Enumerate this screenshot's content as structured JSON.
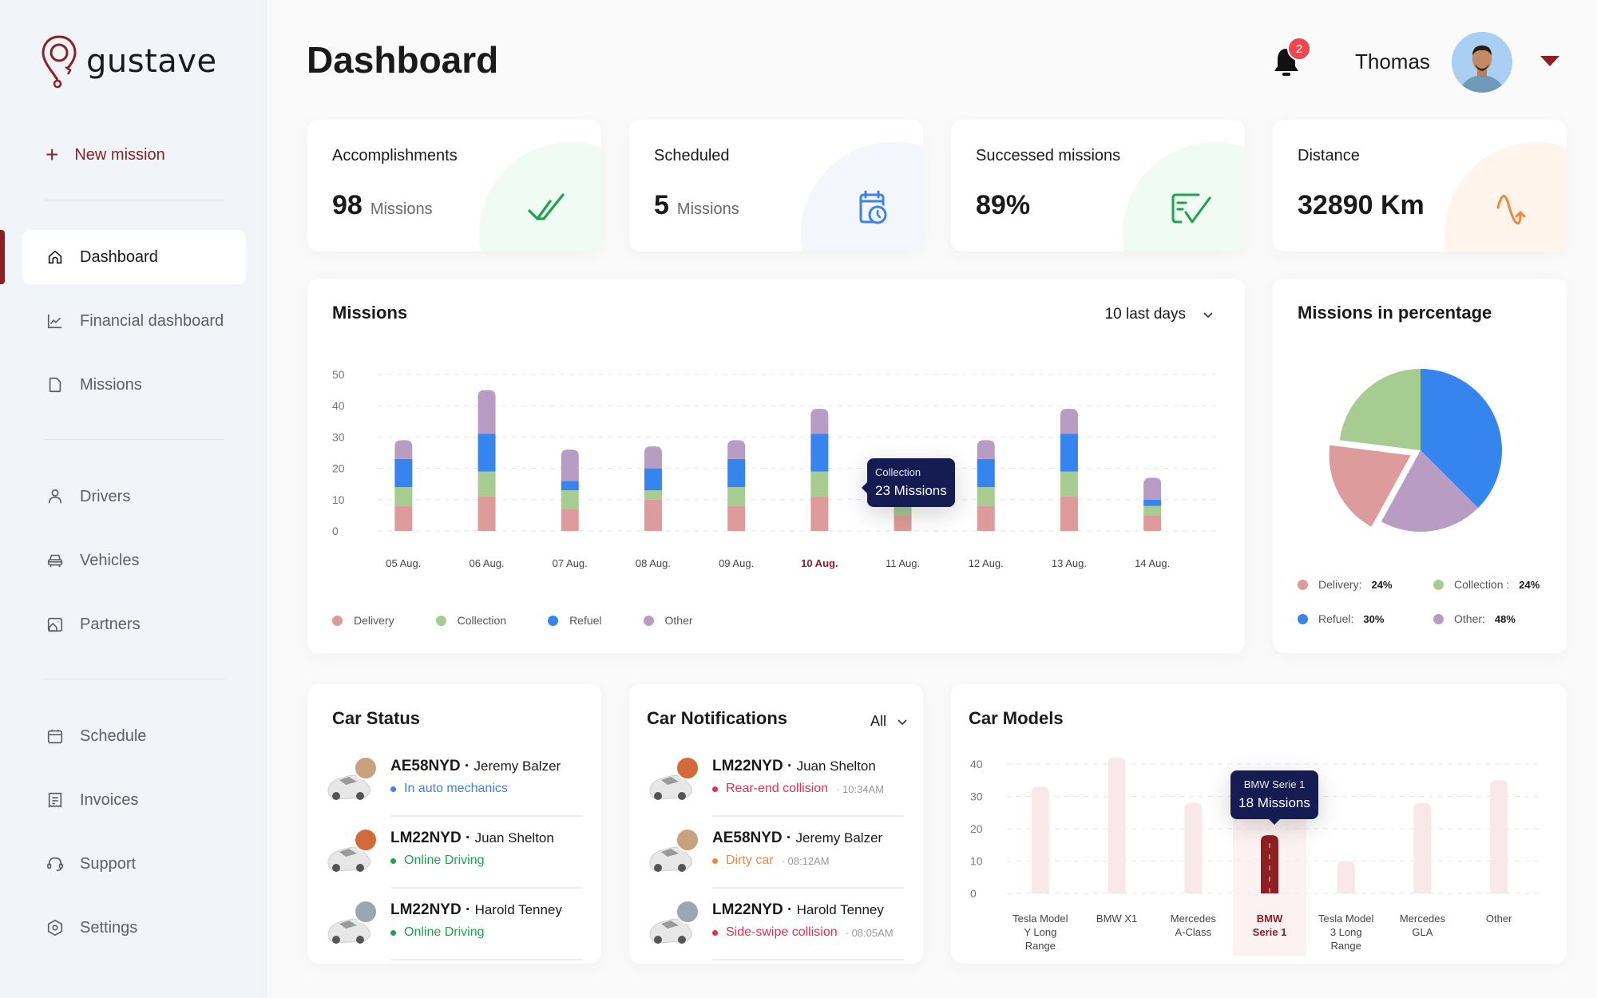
{
  "app": {
    "brand": "gustave"
  },
  "sidebar": {
    "new_mission": "New mission",
    "items": [
      {
        "label": "Dashboard",
        "icon": "home-icon",
        "active": true
      },
      {
        "label": "Financial dashboard",
        "icon": "line-chart-icon"
      },
      {
        "label": "Missions",
        "icon": "document-icon"
      },
      {
        "label": "Drivers",
        "icon": "user-icon"
      },
      {
        "label": "Vehicles",
        "icon": "car-icon"
      },
      {
        "label": "Partners",
        "icon": "building-icon"
      },
      {
        "label": "Schedule",
        "icon": "calendar-icon"
      },
      {
        "label": "Invoices",
        "icon": "receipt-icon"
      },
      {
        "label": "Support",
        "icon": "headset-icon"
      },
      {
        "label": "Settings",
        "icon": "settings-icon"
      }
    ]
  },
  "header": {
    "title": "Dashboard",
    "notifications_count": "2",
    "user_name": "Thomas"
  },
  "stats": [
    {
      "label": "Accomplishments",
      "value": "98",
      "unit": "Missions",
      "icon": "double-check-icon",
      "color": "#1fa34a",
      "bg": "#f0fbf3"
    },
    {
      "label": "Scheduled",
      "value": "5",
      "unit": "Missions",
      "icon": "calendar-clock-icon",
      "color": "#3b82f0",
      "bg": "#f3f7fd"
    },
    {
      "label": "Successed missions",
      "value": "89%",
      "unit": "",
      "icon": "checklist-icon",
      "color": "#1fa34a",
      "bg": "#f0fbf3"
    },
    {
      "label": "Distance",
      "value": "32890 Km",
      "unit": "",
      "icon": "route-icon",
      "color": "#f0883a",
      "bg": "#fff5ec"
    }
  ],
  "missions_chart": {
    "title": "Missions",
    "range": "10 last days",
    "tooltip": {
      "label": "Collection",
      "value": "23 Missions"
    },
    "legend": [
      "Delivery",
      "Collection",
      "Refuel",
      "Other"
    ]
  },
  "pie": {
    "title": "Missions in percentage",
    "legend": [
      {
        "label": "Delivery:",
        "pct": "24%",
        "color": "#de9b9b"
      },
      {
        "label": "Collection :",
        "pct": "24%",
        "color": "#a6cc92"
      },
      {
        "label": "Refuel:",
        "pct": "30%",
        "color": "#3685ef"
      },
      {
        "label": "Other:",
        "pct": "48%",
        "color": "#b89cc4"
      }
    ]
  },
  "car_status": {
    "title": "Car Status",
    "items": [
      {
        "plate": "AE58NYD",
        "driver": "Jeremy Balzer",
        "status": "In auto mechanics",
        "color": "#3b82f0",
        "time": ""
      },
      {
        "plate": "LM22NYD",
        "driver": "Juan Shelton",
        "status": "Online Driving",
        "color": "#1fa34a",
        "time": ""
      },
      {
        "plate": "LM22NYD",
        "driver": "Harold Tenney",
        "status": "Online Driving",
        "color": "#1fa34a",
        "time": ""
      }
    ]
  },
  "car_notifications": {
    "title": "Car Notifications",
    "filter": "All",
    "items": [
      {
        "plate": "LM22NYD",
        "driver": "Juan Shelton",
        "status": "Rear-end collision",
        "color": "#ec2d4b",
        "time": "10:34AM"
      },
      {
        "plate": "AE58NYD",
        "driver": "Jeremy Balzer",
        "status": "Dirty car",
        "color": "#f0883a",
        "time": "08:12AM"
      },
      {
        "plate": "LM22NYD",
        "driver": "Harold Tenney",
        "status": "Side-swipe collision",
        "color": "#ec2d4b",
        "time": "08:05AM"
      }
    ]
  },
  "car_models": {
    "title": "Car Models",
    "tooltip": {
      "label": "BMW Serie 1",
      "value": "18 Missions"
    }
  },
  "chart_data": [
    {
      "type": "bar",
      "stacked": true,
      "title": "Missions",
      "categories": [
        "05 Aug.",
        "06 Aug.",
        "07 Aug.",
        "08 Aug.",
        "09 Aug.",
        "10 Aug.",
        "11 Aug.",
        "12 Aug.",
        "13 Aug.",
        "14 Aug."
      ],
      "highlighted_category": "10 Aug.",
      "series": [
        {
          "name": "Delivery",
          "color": "#de9b9b",
          "values": [
            8,
            11,
            7,
            10,
            8,
            11,
            5,
            8,
            11,
            5
          ]
        },
        {
          "name": "Collection",
          "color": "#a6cc92",
          "values": [
            6,
            8,
            6,
            3,
            6,
            8,
            4,
            6,
            8,
            3
          ]
        },
        {
          "name": "Refuel",
          "color": "#3685ef",
          "values": [
            9,
            12,
            3,
            7,
            9,
            12,
            5,
            9,
            12,
            2
          ]
        },
        {
          "name": "Other",
          "color": "#b89cc4",
          "values": [
            6,
            14,
            10,
            7,
            6,
            8,
            6,
            6,
            8,
            7
          ]
        }
      ],
      "yticks": [
        0,
        10,
        20,
        30,
        40,
        50
      ],
      "ylim": [
        0,
        50
      ],
      "grid": true,
      "legend": "bottom-left"
    },
    {
      "type": "pie",
      "title": "Missions in percentage",
      "slices": [
        {
          "name": "Refuel",
          "value": 37.5,
          "color": "#3685ef"
        },
        {
          "name": "Other",
          "value": 20.5,
          "color": "#b89cc4"
        },
        {
          "name": "Delivery",
          "value": 19,
          "color": "#de9b9b",
          "exploded": true
        },
        {
          "name": "Collection",
          "value": 23,
          "color": "#a6cc92"
        }
      ],
      "legend": "bottom"
    },
    {
      "type": "bar",
      "title": "Car Models",
      "categories": [
        "Tesla Model Y Long Range",
        "BMW X1",
        "Mercedes A-Class",
        "BMW Serie 1",
        "Tesla Model 3 Long Range",
        "Mercedes GLA",
        "Other"
      ],
      "category_lines": [
        [
          "Tesla Model",
          "Y Long",
          "Range"
        ],
        [
          "BMW X1"
        ],
        [
          "Mercedes",
          "A-Class"
        ],
        [
          "BMW",
          "Serie 1"
        ],
        [
          "Tesla Model",
          "3 Long",
          "Range"
        ],
        [
          "Mercedes",
          "GLA"
        ],
        [
          "Other"
        ]
      ],
      "values": [
        33,
        42,
        28,
        18,
        10,
        28,
        35
      ],
      "highlighted_category": "BMW Serie 1",
      "yticks": [
        0,
        10,
        20,
        30,
        40
      ],
      "ylim": [
        0,
        40
      ],
      "grid": true
    }
  ]
}
